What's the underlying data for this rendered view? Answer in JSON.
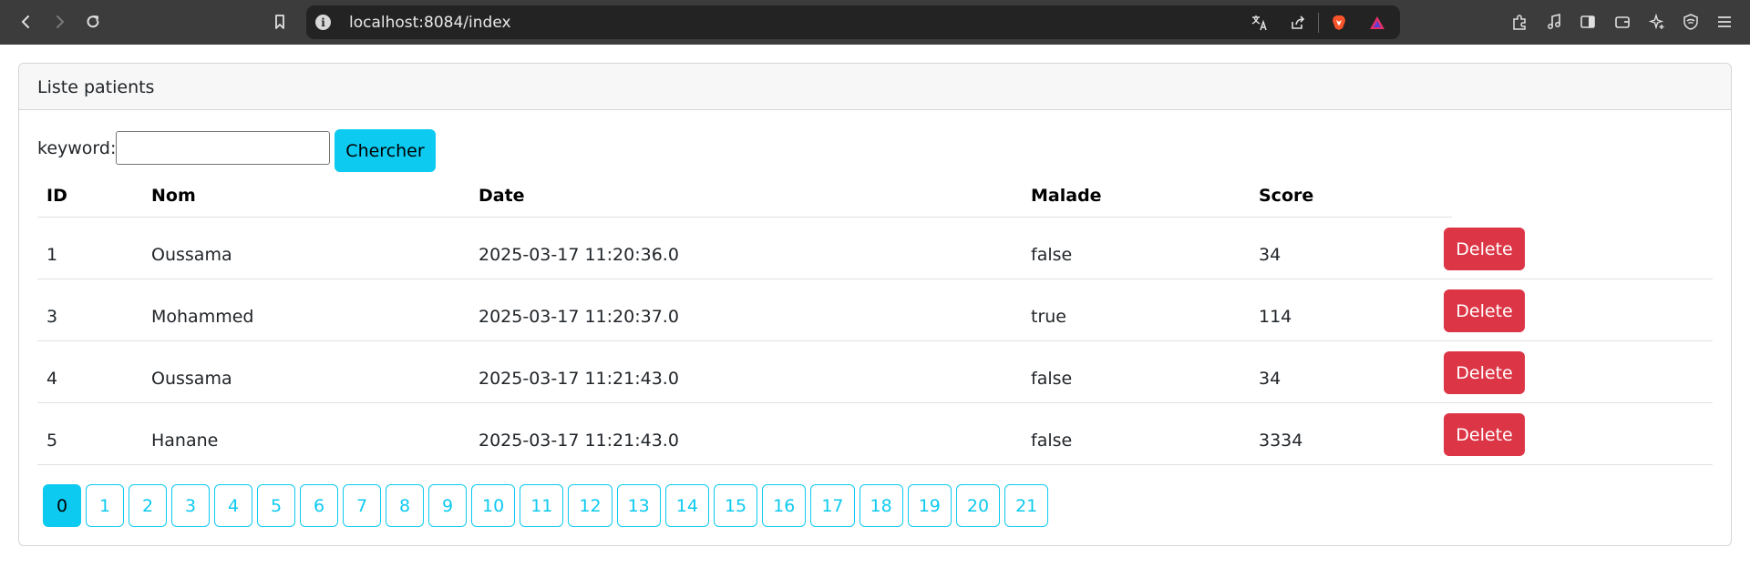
{
  "browser": {
    "url": "localhost:8084/index",
    "info_glyph": "i"
  },
  "card": {
    "title": "Liste patients"
  },
  "search": {
    "label": "keyword:",
    "value": "",
    "button_label": "Chercher"
  },
  "table": {
    "headers": [
      "ID",
      "Nom",
      "Date",
      "Malade",
      "Score"
    ],
    "rows": [
      {
        "id": "1",
        "nom": "Oussama",
        "date": "2025-03-17 11:20:36.0",
        "malade": "false",
        "score": "34",
        "action": "Delete"
      },
      {
        "id": "3",
        "nom": "Mohammed",
        "date": "2025-03-17 11:20:37.0",
        "malade": "true",
        "score": "114",
        "action": "Delete"
      },
      {
        "id": "4",
        "nom": "Oussama",
        "date": "2025-03-17 11:21:43.0",
        "malade": "false",
        "score": "34",
        "action": "Delete"
      },
      {
        "id": "5",
        "nom": "Hanane",
        "date": "2025-03-17 11:21:43.0",
        "malade": "false",
        "score": "3334",
        "action": "Delete"
      }
    ]
  },
  "pagination": {
    "pages": [
      "0",
      "1",
      "2",
      "3",
      "4",
      "5",
      "6",
      "7",
      "8",
      "9",
      "10",
      "11",
      "12",
      "13",
      "14",
      "15",
      "16",
      "17",
      "18",
      "19",
      "20",
      "21"
    ],
    "current": "0"
  },
  "colors": {
    "info": "#0dcaf0",
    "danger": "#dc3545",
    "chrome": "#3c3c3c",
    "urlbar": "#232323"
  }
}
